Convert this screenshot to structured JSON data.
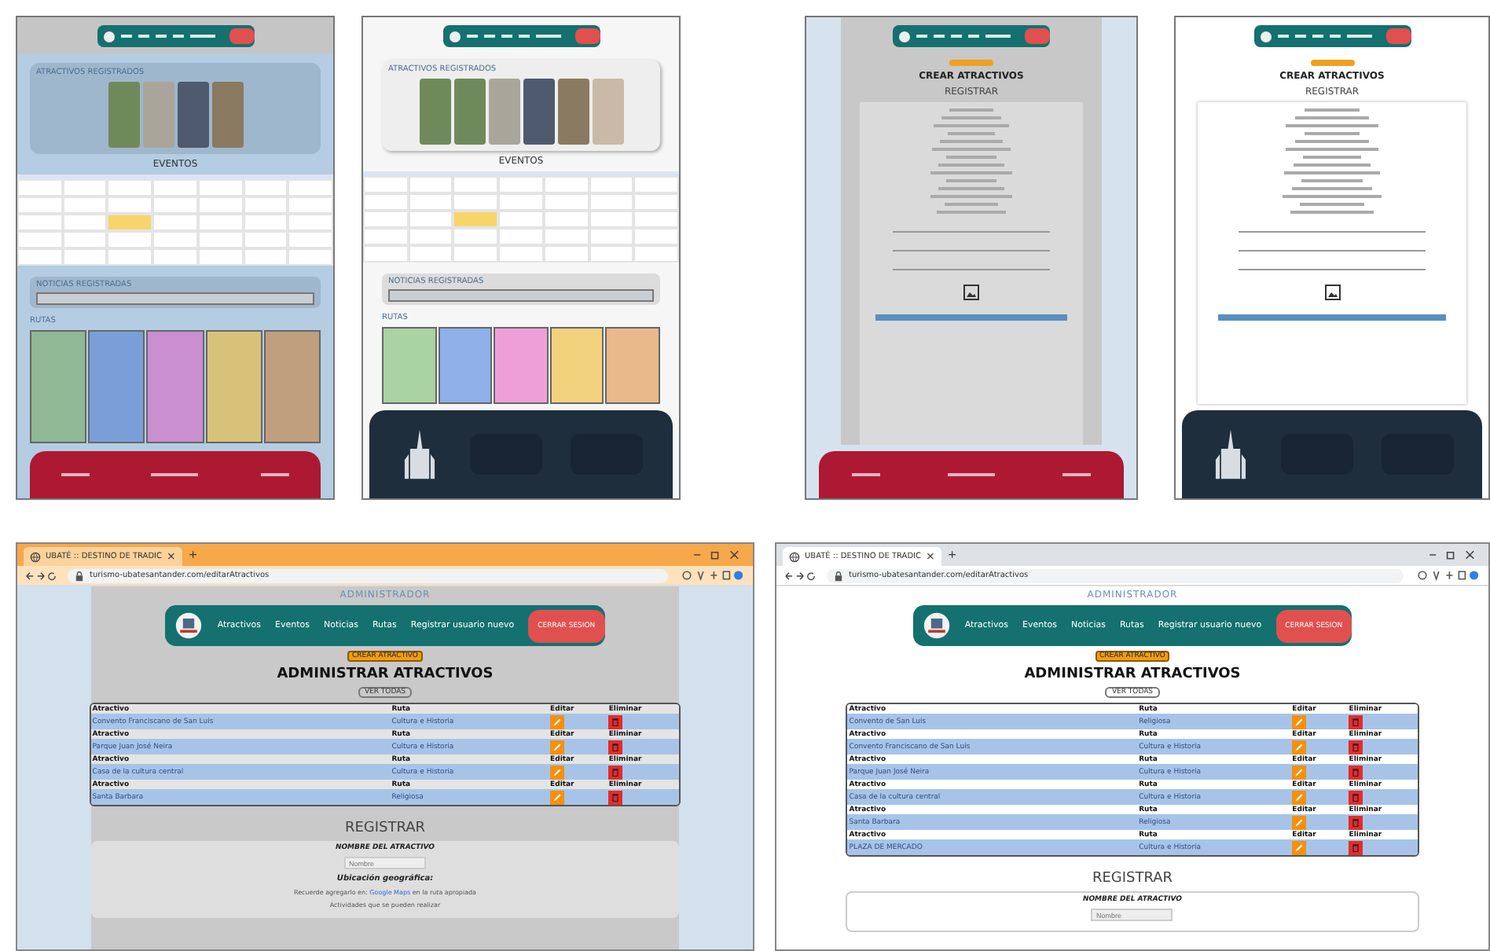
{
  "thumbnails": [
    {
      "kind": "home",
      "attractions_title": "ATRACTIVOS REGISTRADOS",
      "events_title": "EVENTOS",
      "news_title": "NOTICIAS REGISTRADAS",
      "routes_title": "RUTAS",
      "routes": [
        {
          "color": "#8fb894"
        },
        {
          "color": "#7a9fd8"
        },
        {
          "color": "#c98fcf"
        },
        {
          "color": "#d8c27a"
        },
        {
          "color": "#bf9f7d"
        }
      ]
    },
    {
      "kind": "home",
      "attractions_title": "ATRACTIVOS REGISTRADOS",
      "events_title": "EVENTOS",
      "news_title": "NOTICIAS REGISTRADAS",
      "routes_title": "RUTAS",
      "routes": [
        {
          "color": "#a9d3a0"
        },
        {
          "color": "#8fb0e8"
        },
        {
          "color": "#ee9fd8"
        },
        {
          "color": "#f3d27e"
        },
        {
          "color": "#e9b98c"
        }
      ]
    },
    {
      "kind": "create",
      "title": "CREAR ATRACTIVOS",
      "register_title": "REGISTRAR"
    },
    {
      "kind": "create",
      "title": "CREAR ATRACTIVOS",
      "register_title": "REGISTRAR"
    }
  ],
  "browsers": [
    {
      "tab_title": "UBATÉ :: DESTINO DE TRADIC",
      "tab_close": "×",
      "new_tab": "+",
      "url": "turismo-ubatesantander.com/editarAtractivos",
      "header": "ADMINISTRADOR",
      "nav": [
        "Atractivos",
        "Eventos",
        "Noticias",
        "Rutas",
        "Registrar usuario nuevo"
      ],
      "logout": "CERRAR SESION",
      "create_button": "CREAR ATRACTIVO",
      "title": "ADMINISTRAR ATRACTIVOS",
      "view_all": "VER TODAS",
      "rows": [
        {
          "columns": [
            "Atractivo",
            "Ruta",
            "Editar",
            "Eliminar"
          ],
          "name": "Convento Franciscano de San Luis",
          "route": "Cultura e Historia"
        },
        {
          "columns": [
            "Atractivo",
            "Ruta",
            "Editar",
            "Eliminar"
          ],
          "name": "Parque Juan José Neira",
          "route": "Cultura e Historia"
        },
        {
          "columns": [
            "Atractivo",
            "Ruta",
            "Editar",
            "Eliminar"
          ],
          "name": "Casa de la cultura central",
          "route": "Cultura e Historia"
        },
        {
          "columns": [
            "Atractivo",
            "Ruta",
            "Editar",
            "Eliminar"
          ],
          "name": "Santa Barbara",
          "route": "Religiosa"
        }
      ],
      "register_title": "REGISTRAR",
      "form": {
        "name_label": "NOMBRE DEL ATRACTIVO",
        "placeholder": "Nombre",
        "location_label": "Ubicación geográfica:",
        "note": "Recuerde agregarlo en:",
        "note_link": "Google Maps",
        "note_end": "en la ruta apropiada",
        "activities_label": "Actividades que se pueden realizar"
      }
    },
    {
      "tab_title": "UBATÉ :: DESTINO DE TRADIC",
      "tab_close": "×",
      "new_tab": "+",
      "url": "turismo-ubatesantander.com/editarAtractivos",
      "header": "ADMINISTRADOR",
      "nav": [
        "Atractivos",
        "Eventos",
        "Noticias",
        "Rutas",
        "Registrar usuario nuevo"
      ],
      "logout": "CERRAR SESION",
      "create_button": "CREAR ATRACTIVO",
      "title": "ADMINISTRAR ATRACTIVOS",
      "view_all": "VER TODAS",
      "rows": [
        {
          "columns": [
            "Atractivo",
            "Ruta",
            "Editar",
            "Eliminar"
          ],
          "name": "Convento de San Luis",
          "route": "Religiosa"
        },
        {
          "columns": [
            "Atractivo",
            "Ruta",
            "Editar",
            "Eliminar"
          ],
          "name": "Convento Franciscano de San Luis",
          "route": "Cultura e Historia"
        },
        {
          "columns": [
            "Atractivo",
            "Ruta",
            "Editar",
            "Eliminar"
          ],
          "name": "Parque Juan José Neira",
          "route": "Cultura e Historia"
        },
        {
          "columns": [
            "Atractivo",
            "Ruta",
            "Editar",
            "Eliminar"
          ],
          "name": "Casa de la cultura central",
          "route": "Cultura e Historia"
        },
        {
          "columns": [
            "Atractivo",
            "Ruta",
            "Editar",
            "Eliminar"
          ],
          "name": "Santa Barbara",
          "route": "Religiosa"
        },
        {
          "columns": [
            "Atractivo",
            "Ruta",
            "Editar",
            "Eliminar"
          ],
          "name": "PLAZA DE MERCADO",
          "route": "Cultura e Historia"
        }
      ],
      "register_title": "REGISTRAR",
      "form": {
        "name_label": "NOMBRE DEL ATRACTIVO",
        "placeholder": "Nombre"
      }
    }
  ]
}
